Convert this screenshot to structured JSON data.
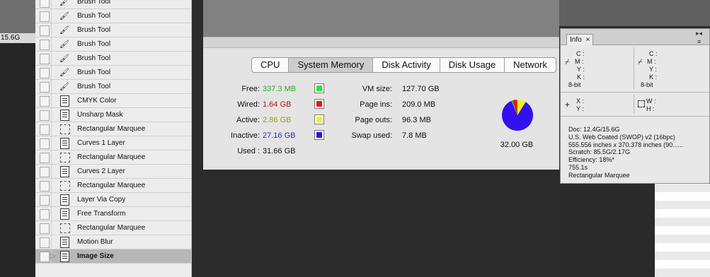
{
  "left_edge": {
    "label": "15.6G"
  },
  "history": {
    "items": [
      {
        "label": "Brush Tool",
        "icon": "brush-icon"
      },
      {
        "label": "Brush Tool",
        "icon": "brush-icon"
      },
      {
        "label": "Brush Tool",
        "icon": "brush-icon"
      },
      {
        "label": "Brush Tool",
        "icon": "brush-icon"
      },
      {
        "label": "Brush Tool",
        "icon": "brush-icon"
      },
      {
        "label": "Brush Tool",
        "icon": "brush-icon"
      },
      {
        "label": "Brush Tool",
        "icon": "brush-icon"
      },
      {
        "label": "CMYK Color",
        "icon": "document-icon"
      },
      {
        "label": "Unsharp Mask",
        "icon": "document-icon"
      },
      {
        "label": "Rectangular Marquee",
        "icon": "marquee-icon"
      },
      {
        "label": "Curves 1 Layer",
        "icon": "document-icon"
      },
      {
        "label": "Rectangular Marquee",
        "icon": "marquee-icon"
      },
      {
        "label": "Curves 2 Layer",
        "icon": "document-icon"
      },
      {
        "label": "Rectangular Marquee",
        "icon": "marquee-icon"
      },
      {
        "label": "Layer Via Copy",
        "icon": "document-icon"
      },
      {
        "label": "Free Transform",
        "icon": "document-icon"
      },
      {
        "label": "Rectangular Marquee",
        "icon": "marquee-icon"
      },
      {
        "label": "Motion Blur",
        "icon": "document-icon"
      },
      {
        "label": "Image Size",
        "icon": "document-icon",
        "selected": true
      }
    ]
  },
  "activity_monitor": {
    "tabs": [
      "CPU",
      "System Memory",
      "Disk Activity",
      "Disk Usage",
      "Network"
    ],
    "active_tab": "System Memory",
    "memory": [
      {
        "label": "Free:",
        "value": "337.3 MB",
        "color": "#27a827",
        "swatch": "#33dd33"
      },
      {
        "label": "Wired:",
        "value": "1.64 GB",
        "color": "#b01616",
        "swatch": "#e01818"
      },
      {
        "label": "Active:",
        "value": "2.86 GB",
        "color": "#9a9a1a",
        "swatch": "#f2f21a"
      },
      {
        "label": "Inactive:",
        "value": "27.16 GB",
        "color": "#2a2ad0",
        "swatch": "#2f11e8"
      },
      {
        "label": "Used :",
        "value": "31.66 GB",
        "color": "#111111",
        "swatch": null
      }
    ],
    "vm": [
      {
        "label": "VM size:",
        "value": "127.70 GB"
      },
      {
        "label": "Page ins:",
        "value": "209.0 MB"
      },
      {
        "label": "Page outs:",
        "value": "96.3 MB"
      },
      {
        "label": "Swap used:",
        "value": "7.8 MB"
      }
    ],
    "total": "32.00 GB",
    "pie": [
      {
        "name": "Inactive",
        "value": 27.16,
        "color": "#3311ee"
      },
      {
        "name": "Free",
        "value": 0.3373,
        "color": "#33dd33"
      },
      {
        "name": "Wired",
        "value": 1.64,
        "color": "#e01818"
      },
      {
        "name": "Active",
        "value": 2.86,
        "color": "#f2f21a"
      }
    ]
  },
  "info_panel": {
    "tab": "Info",
    "close": "×",
    "cmyk_left": {
      "c": "C :",
      "m": "M :",
      "y": "Y :",
      "k": "K :",
      "bit": "8-bit"
    },
    "cmyk_right": {
      "c": "C :",
      "m": "M :",
      "y": "Y :",
      "k": "K :",
      "bit": "8-bit"
    },
    "xy": {
      "x": "X :",
      "y": "Y :"
    },
    "wh": {
      "w": "W :",
      "h": "H :"
    },
    "doc_lines": [
      "Doc: 12.4G/15.6G",
      "U.S. Web Coated (SWOP) v2 (16bpc)",
      "555.556 inches x 370.378 inches (90......",
      "Scratch: 85.5G/2.17G",
      "Efficiency: 18%*",
      "755.1s",
      "Rectangular Marquee"
    ]
  }
}
